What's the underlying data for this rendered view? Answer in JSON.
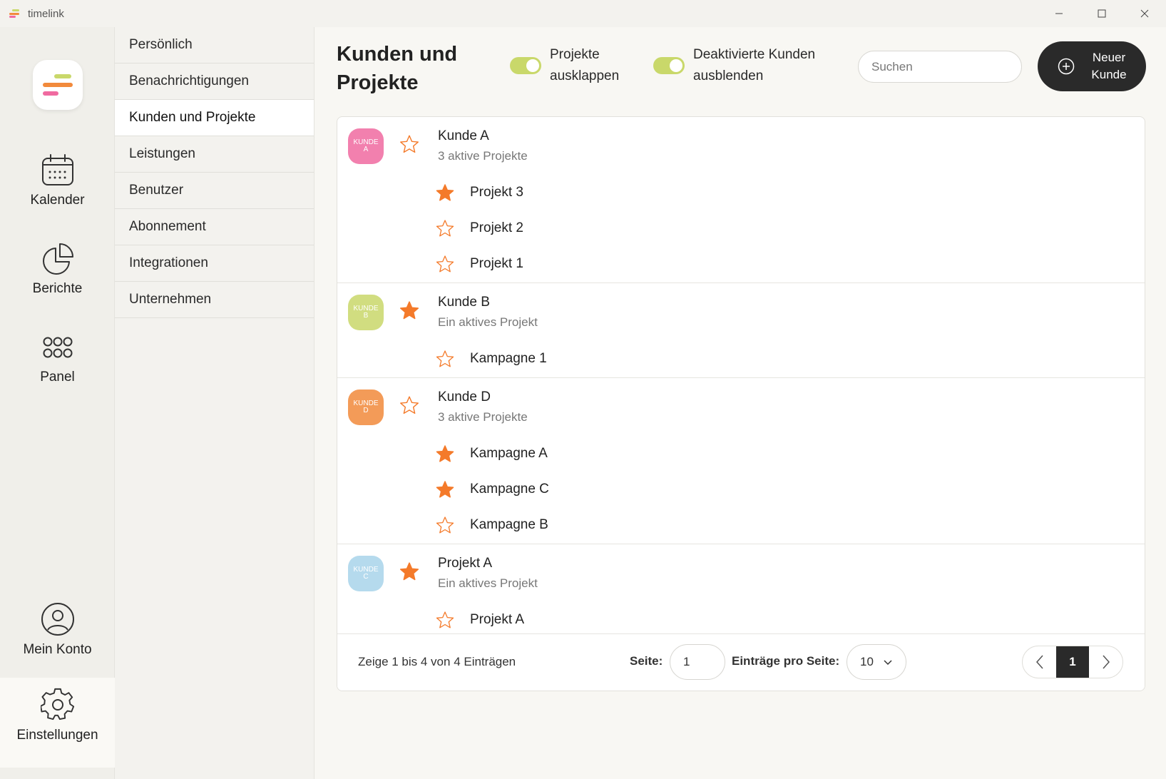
{
  "window": {
    "title": "timelink",
    "controls": [
      "minimize",
      "maximize",
      "close"
    ]
  },
  "brand_colors": {
    "pink": "#f06aa0",
    "green": "#c9d86a",
    "orange": "#f28a3c",
    "blue": "#a9d4ea",
    "dark": "#2a2a2a",
    "star": "#f47a2a"
  },
  "rail": {
    "items": [
      {
        "label": "Kalender",
        "icon": "calendar-icon"
      },
      {
        "label": "Berichte",
        "icon": "pie-chart-icon"
      },
      {
        "label": "Panel",
        "icon": "grid-icon"
      },
      {
        "label": "Mein Konto",
        "icon": "user-circle-icon"
      },
      {
        "label": "Einstellungen",
        "icon": "gear-icon"
      }
    ],
    "active": "Einstellungen"
  },
  "submenu": {
    "items": [
      {
        "label": "Persönlich"
      },
      {
        "label": "Benachrichtigungen"
      },
      {
        "label": "Kunden und Projekte"
      },
      {
        "label": "Leistungen"
      },
      {
        "label": "Benutzer"
      },
      {
        "label": "Abonnement"
      },
      {
        "label": "Integrationen"
      },
      {
        "label": "Unternehmen"
      }
    ],
    "active": "Kunden und Projekte"
  },
  "header": {
    "title": "Kunden und Projekte",
    "toggle_projects": {
      "label": "Projekte ausklappen",
      "on": true
    },
    "toggle_inactive": {
      "label": "Deaktivierte Kunden ausblenden",
      "on": true
    },
    "search_placeholder": "Suchen",
    "new_button": "Neuer Kunde"
  },
  "customers": [
    {
      "name": "Kunde A",
      "subtitle": "3 aktive Projekte",
      "avatar_text": "KUNDE A",
      "color": "#f06aa0",
      "favorite": false,
      "projects": [
        {
          "name": "Projekt 3",
          "favorite": true
        },
        {
          "name": "Projekt 2",
          "favorite": false
        },
        {
          "name": "Projekt 1",
          "favorite": false
        }
      ]
    },
    {
      "name": "Kunde B",
      "subtitle": "Ein aktives Projekt",
      "avatar_text": "KUNDE B",
      "color": "#c9d86a",
      "favorite": true,
      "projects": [
        {
          "name": "Kampagne 1",
          "favorite": false
        }
      ]
    },
    {
      "name": "Kunde D",
      "subtitle": "3 aktive Projekte",
      "avatar_text": "KUNDE D",
      "color": "#f28a3c",
      "favorite": false,
      "projects": [
        {
          "name": "Kampagne A",
          "favorite": true
        },
        {
          "name": "Kampagne C",
          "favorite": true
        },
        {
          "name": "Kampagne B",
          "favorite": false
        }
      ]
    },
    {
      "name": "Projekt A",
      "subtitle": "Ein aktives Projekt",
      "avatar_text": "KUNDE C",
      "color": "#a9d4ea",
      "favorite": true,
      "projects": [
        {
          "name": "Projekt A",
          "favorite": false
        }
      ]
    }
  ],
  "footer": {
    "info": "Zeige 1 bis 4 von 4 Einträgen",
    "page_label": "Seite:",
    "page_value": "1",
    "per_page_label": "Einträge pro Seite:",
    "per_page_value": "10",
    "current_page": "1"
  }
}
